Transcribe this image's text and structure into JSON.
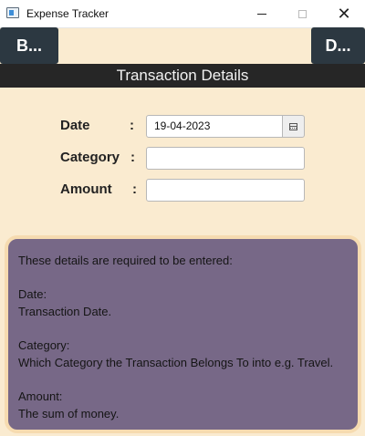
{
  "window": {
    "title": "Expense Tracker",
    "minimize_label": "—",
    "close_label": "✕"
  },
  "nav": {
    "back_label": "B...",
    "delete_label": "D..."
  },
  "header": {
    "title": "Transaction Details"
  },
  "form": {
    "date": {
      "label": "Date",
      "colon": ":",
      "value": "19-04-2023"
    },
    "category": {
      "label": "Category",
      "colon": ":",
      "value": ""
    },
    "amount": {
      "label": "Amount",
      "colon": ":",
      "value": ""
    }
  },
  "info": {
    "intro": "These details are required to be entered:",
    "date_heading": "Date:",
    "date_desc": "Transaction Date.",
    "category_heading": "Category:",
    "category_desc": "Which Category the Transaction Belongs To into e.g. Travel.",
    "amount_heading": "Amount:",
    "amount_desc": "The sum of money."
  },
  "icons": {
    "app": "app-window-icon",
    "calendar": "calendar-icon"
  }
}
